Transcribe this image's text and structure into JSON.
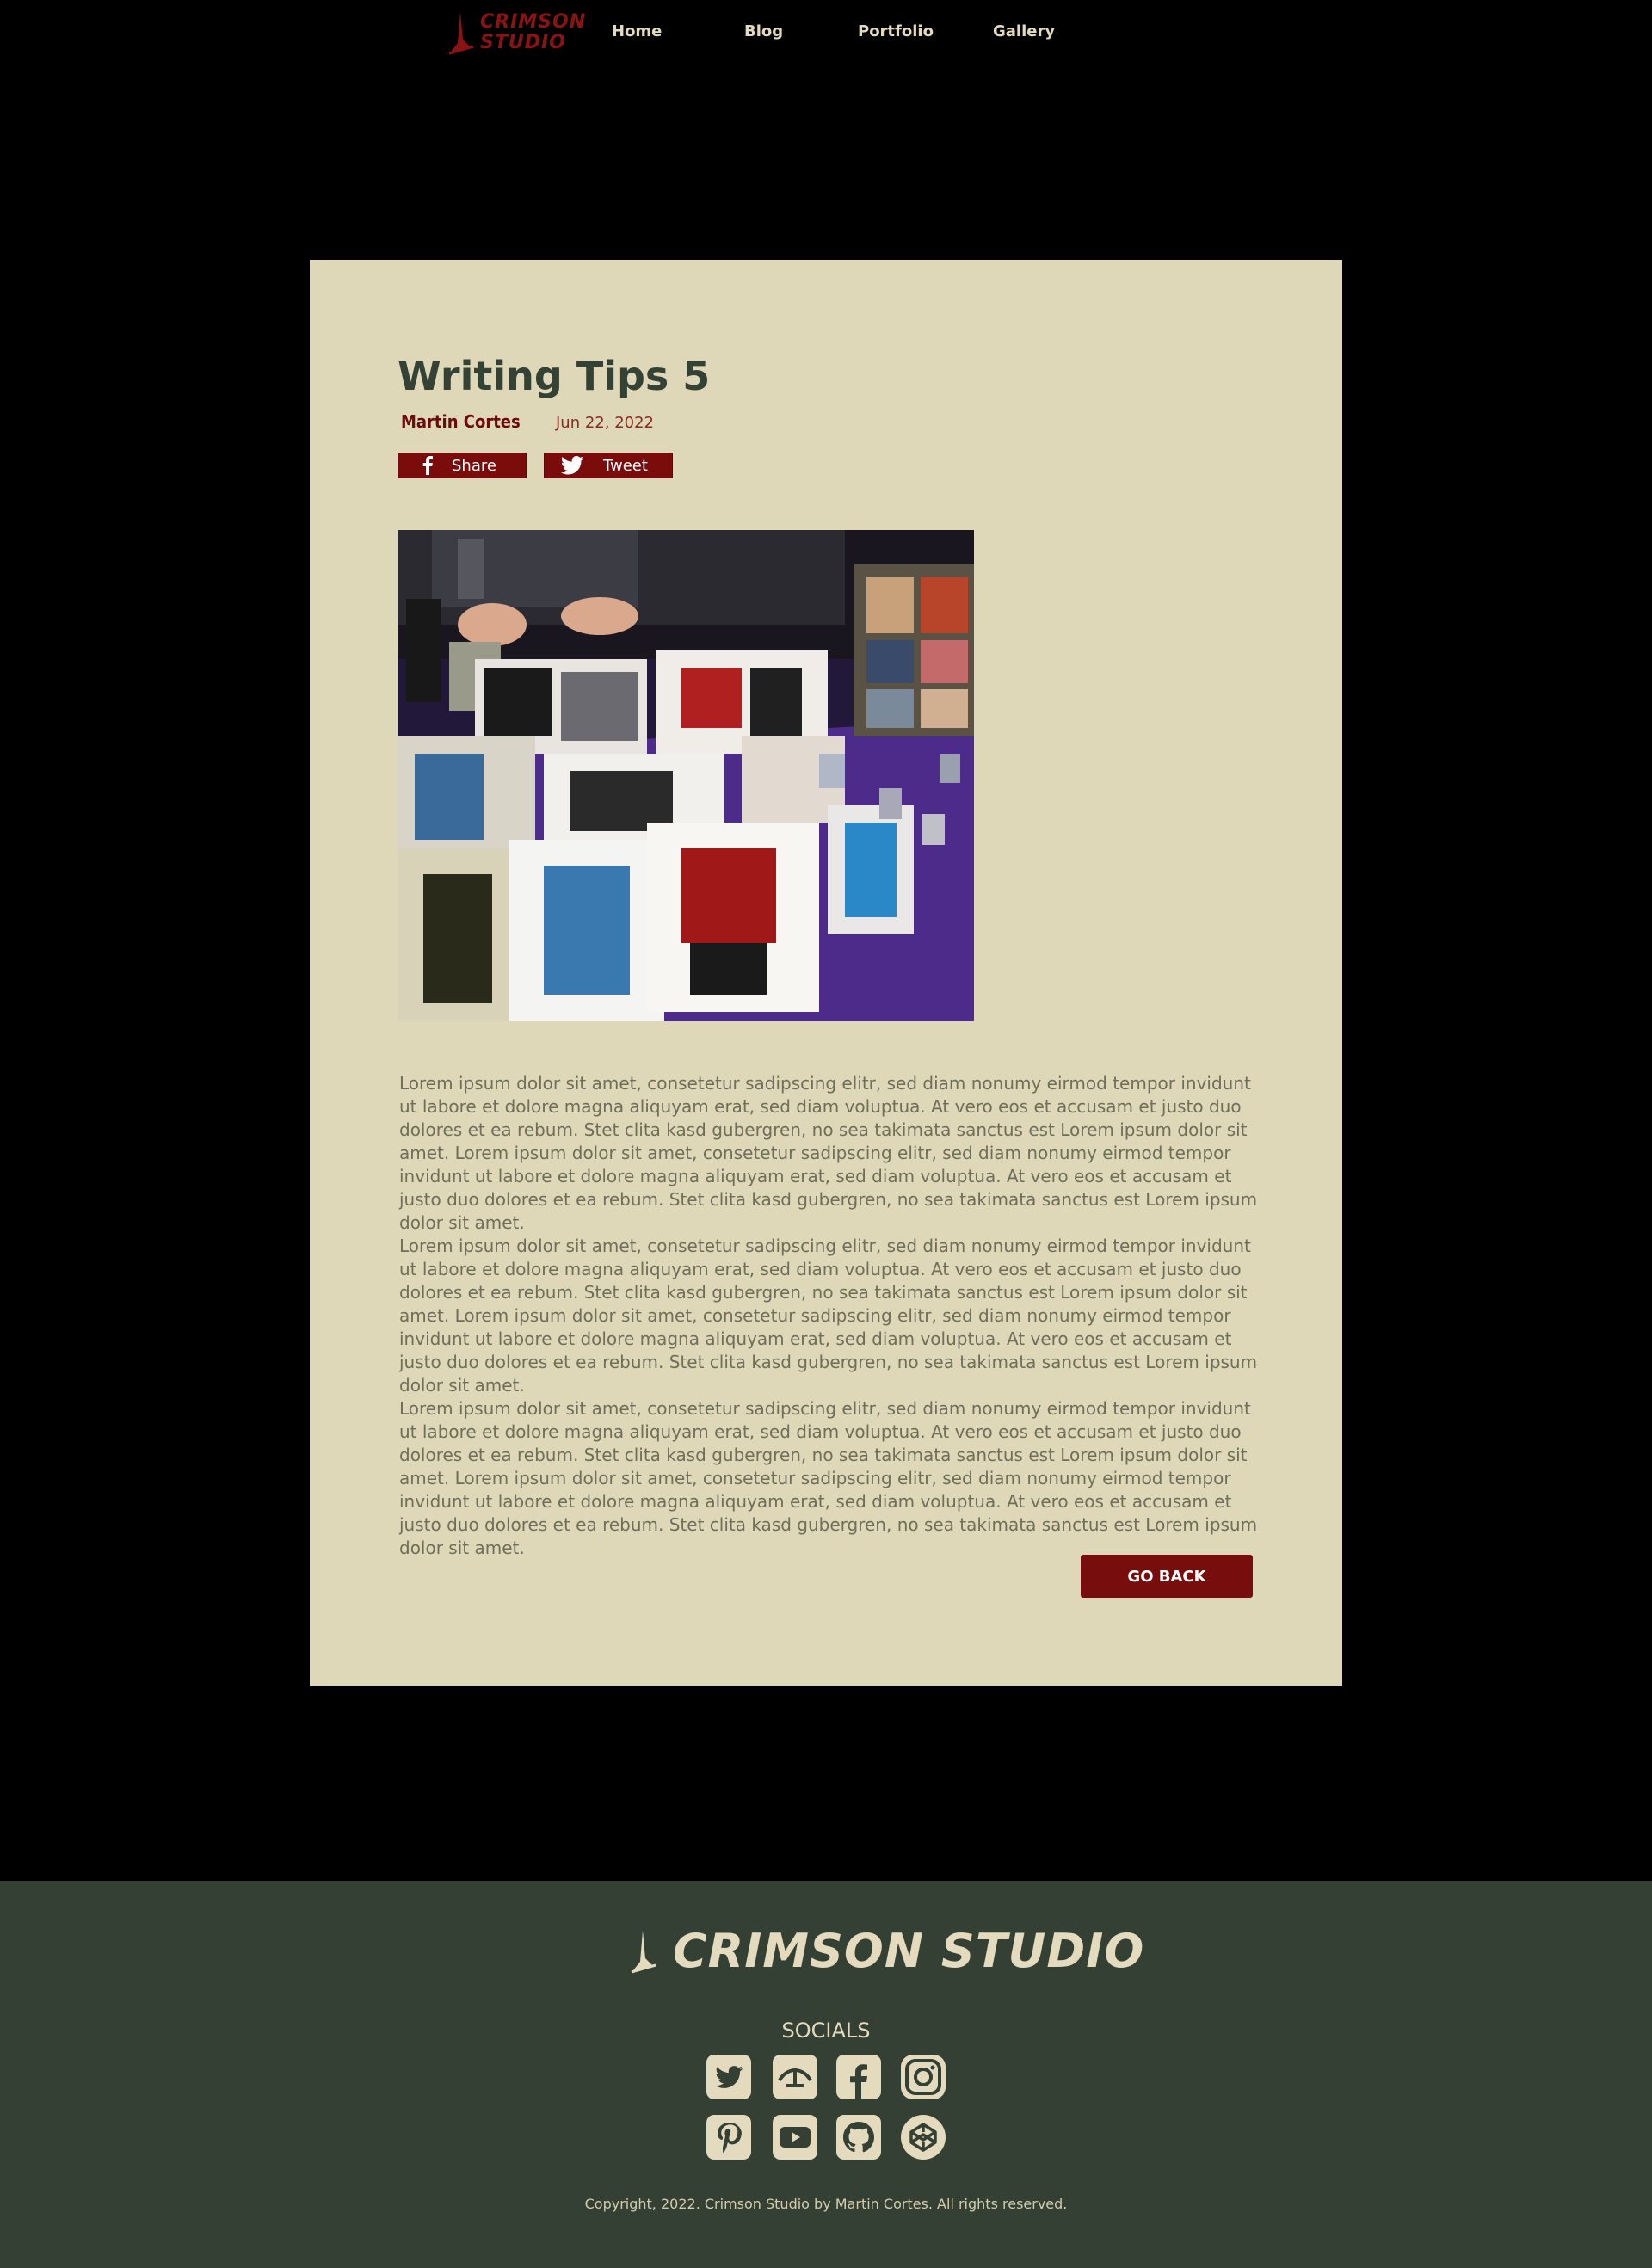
{
  "nav": {
    "logo_line1": "CRIMSON",
    "logo_line2": "STUDIO",
    "links": [
      "Home",
      "Blog",
      "Portfolio",
      "Gallery"
    ]
  },
  "post": {
    "title": "Writing Tips 5",
    "author": "Martin Cortes",
    "date": "Jun 22, 2022",
    "share_label": "Share",
    "tweet_label": "Tweet",
    "paragraphs": [
      "Lorem ipsum dolor sit amet, consetetur sadipscing elitr, sed diam nonumy eirmod tempor invidunt ut labore et dolore magna aliquyam erat, sed diam voluptua. At vero eos et accusam et justo duo dolores et ea rebum. Stet clita kasd gubergren, no sea takimata sanctus est Lorem ipsum dolor sit amet. Lorem ipsum dolor sit amet, consetetur sadipscing elitr, sed diam nonumy eirmod tempor invidunt ut labore et dolore magna aliquyam erat, sed diam voluptua. At vero eos et accusam et justo duo dolores et ea rebum. Stet clita kasd gubergren, no sea takimata sanctus est Lorem ipsum dolor sit amet.",
      "Lorem ipsum dolor sit amet, consetetur sadipscing elitr, sed diam nonumy eirmod tempor invidunt ut labore et dolore magna aliquyam erat, sed diam voluptua. At vero eos et accusam et justo duo dolores et ea rebum. Stet clita kasd gubergren, no sea takimata sanctus est Lorem ipsum dolor sit amet. Lorem ipsum dolor sit amet, consetetur sadipscing elitr, sed diam nonumy eirmod tempor invidunt ut labore et dolore magna aliquyam erat, sed diam voluptua. At vero eos et accusam et justo duo dolores et ea rebum. Stet clita kasd gubergren, no sea takimata sanctus est Lorem ipsum dolor sit amet.",
      "Lorem ipsum dolor sit amet, consetetur sadipscing elitr, sed diam nonumy eirmod tempor invidunt ut labore et dolore magna aliquyam erat, sed diam voluptua. At vero eos et accusam et justo duo dolores et ea rebum. Stet clita kasd gubergren, no sea takimata sanctus est Lorem ipsum dolor sit amet. Lorem ipsum dolor sit amet, consetetur sadipscing elitr, sed diam nonumy eirmod tempor invidunt ut labore et dolore magna aliquyam erat, sed diam voluptua. At vero eos et accusam et justo duo dolores et ea rebum. Stet clita kasd gubergren, no sea takimata sanctus est Lorem ipsum dolor sit amet."
    ],
    "go_back_label": "GO BACK"
  },
  "footer": {
    "logo_text": "CRIMSON STUDIO",
    "socials_title": "SOCIALS",
    "social_icons": [
      "twitter-icon",
      "deviantart-icon",
      "facebook-icon",
      "instagram-icon",
      "pinterest-icon",
      "youtube-icon",
      "github-icon",
      "codepen-icon"
    ],
    "copyright": "Copyright, 2022. Crimson Studio by Martin Cortes. All rights reserved."
  },
  "colors": {
    "background": "#000000",
    "card": "#dfd8b8",
    "accent": "#780d0d",
    "title": "#344235",
    "footer": "#334033",
    "footer_text": "#e4dbbf"
  }
}
